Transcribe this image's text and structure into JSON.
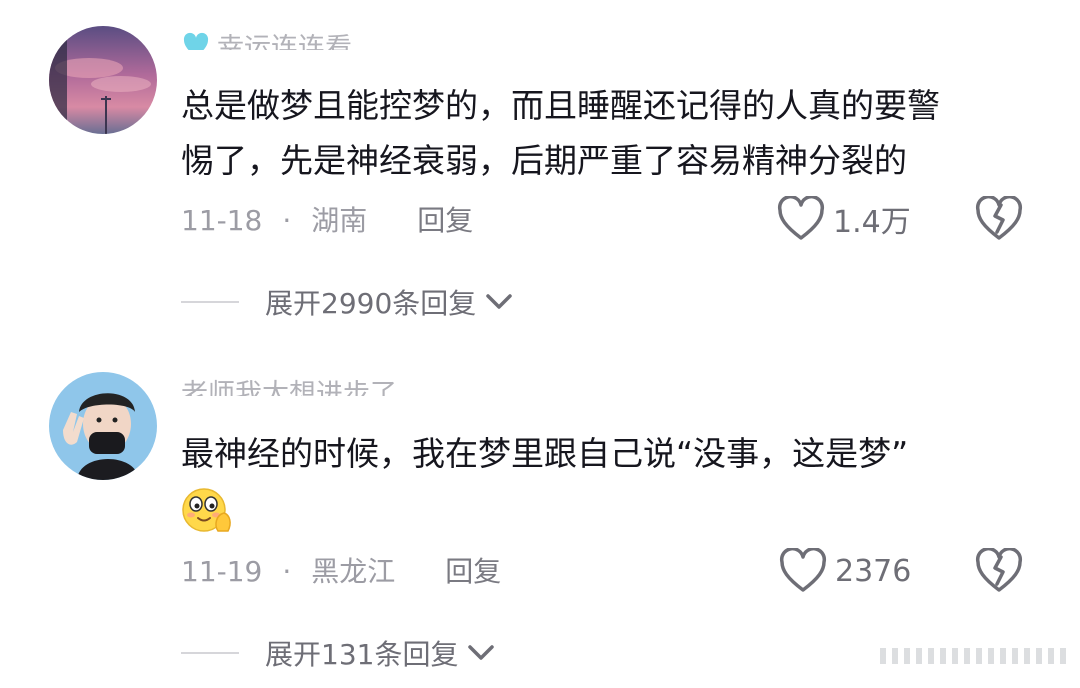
{
  "comments": [
    {
      "username": "幸运连连看",
      "text_lines": [
        "总是做梦且能控梦的，而且睡醒还记得的人真的要警",
        "惕了，先是神经衰弱，后期严重了容易精神分裂的"
      ],
      "date": "11-18",
      "dot": "·",
      "region": "湖南",
      "reply_label": "回复",
      "likes": "1.4万",
      "expand_label": "展开2990条回复"
    },
    {
      "username": "老师我太想进步了",
      "text_lines": [
        "最神经的时候，我在梦里跟自己说“没事，这是梦”"
      ],
      "date": "11-19",
      "dot": "·",
      "region": "黑龙江",
      "reply_label": "回复",
      "likes": "2376",
      "expand_label": "展开131条回复"
    }
  ],
  "icons": {
    "like": "heart-outline-icon",
    "dislike": "broken-heart-icon",
    "expand": "chevron-down-icon",
    "emoji": "emoji-face-icon",
    "user_badge": "heart-badge-icon"
  },
  "colors": {
    "text": "#16161e",
    "meta": "#9c9ca4",
    "icon": "#6e6e76"
  }
}
